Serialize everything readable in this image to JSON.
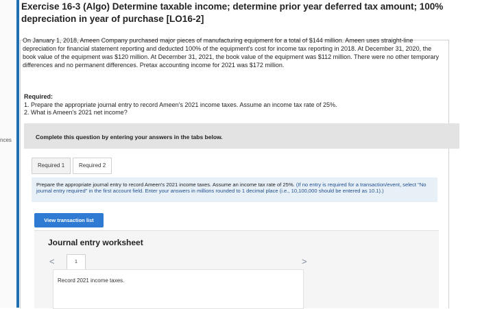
{
  "exercise": {
    "title": "Exercise 16-3 (Algo) Determine taxable income; determine prior year deferred tax amount; 100% depreciation in year of purchase [LO16-2]",
    "side_label": "nces",
    "problem_text": "On January 1, 2018, Ameen Company purchased major pieces of manufacturing equipment for a total of $144 million. Ameen uses straight-line depreciation for financial statement reporting and deducted 100% of the equipment's cost for income tax reporting in 2018. At December 31, 2020, the book value of the equipment was $120 million. At December 31, 2021, the book value of the equipment was $112 million. There were no other temporary differences and no permanent differences. Pretax accounting income for 2021 was $172 million."
  },
  "required": {
    "heading": "Required:",
    "items": [
      "1. Prepare the appropriate journal entry to record Ameen's 2021 income taxes. Assume an income tax rate of 25%.",
      "2. What is Ameen's 2021 net income?"
    ]
  },
  "complete_bar": {
    "text": "Complete this question by entering your answers in the tabs below."
  },
  "tabs": [
    {
      "label": "Required 1"
    },
    {
      "label": "Required 2"
    }
  ],
  "instructions": {
    "main": "Prepare the appropriate journal entry to record Ameen's 2021 income taxes. Assume an income tax rate of 25%.",
    "note": "(If no entry is required for a transaction/event, select \"No journal entry required\" in the first account field. Enter your answers in millions rounded to 1 decimal place (i.e., 10,100,000 should be entered as 10.1).)"
  },
  "view_button": {
    "label": "View transaction list"
  },
  "worksheet": {
    "title": "Journal entry worksheet",
    "entry_number": "1",
    "nav_prev": "<",
    "nav_next": ">",
    "record_text": "Record 2021 income taxes."
  },
  "colors": {
    "accent_bar": "#1f6fb5",
    "button": "#2f7ad3",
    "instruction_bg": "#e7f0f7"
  }
}
